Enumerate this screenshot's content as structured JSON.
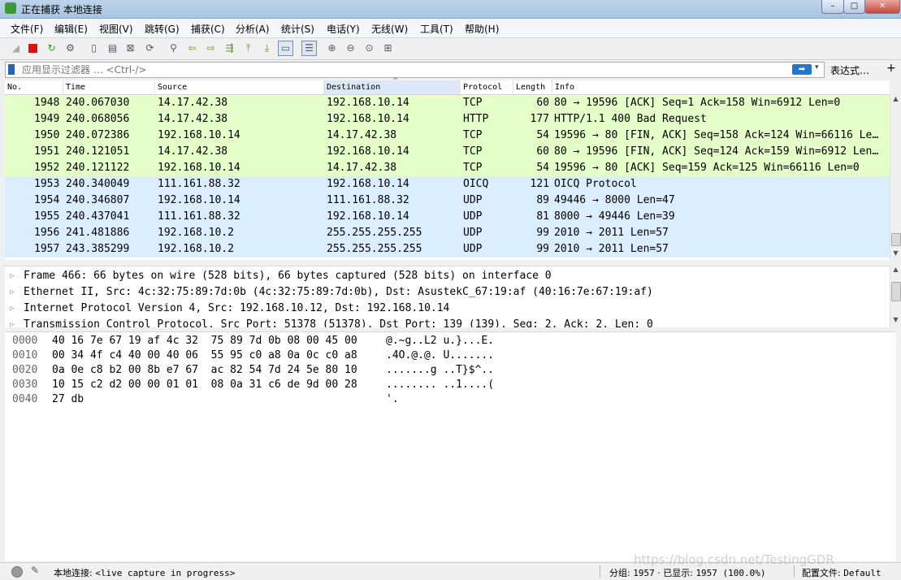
{
  "window": {
    "title": "正在捕获 本地连接",
    "min": "–",
    "max": "□",
    "close": "✕"
  },
  "menu": [
    "文件(F)",
    "编辑(E)",
    "视图(V)",
    "跳转(G)",
    "捕获(C)",
    "分析(A)",
    "统计(S)",
    "电话(Y)",
    "无线(W)",
    "工具(T)",
    "帮助(H)"
  ],
  "filter": {
    "placeholder": "应用显示过滤器 … <Ctrl-/>",
    "apply": "➡",
    "dropdown": "▾",
    "expression_button": "表达式…",
    "add_button": "+"
  },
  "columns": [
    "No.",
    "Time",
    "Source",
    "Destination",
    "Protocol",
    "Length",
    "Info"
  ],
  "sort_indicator": "^",
  "colors": {
    "tcp_row": "#e4ffc7",
    "udp_row": "#daeeff",
    "window_accent": "#a9c4e2"
  },
  "packets": [
    {
      "no": "1948",
      "time": "240.067030",
      "src": "14.17.42.38",
      "dst": "192.168.10.14",
      "proto": "TCP",
      "len": "60",
      "info": "80 → 19596 [ACK] Seq=1 Ack=158 Win=6912 Len=0",
      "kind": "tcp"
    },
    {
      "no": "1949",
      "time": "240.068056",
      "src": "14.17.42.38",
      "dst": "192.168.10.14",
      "proto": "HTTP",
      "len": "177",
      "info": "HTTP/1.1 400 Bad Request",
      "kind": "tcp"
    },
    {
      "no": "1950",
      "time": "240.072386",
      "src": "192.168.10.14",
      "dst": "14.17.42.38",
      "proto": "TCP",
      "len": "54",
      "info": "19596 → 80 [FIN, ACK] Seq=158 Ack=124 Win=66116 Le…",
      "kind": "tcp"
    },
    {
      "no": "1951",
      "time": "240.121051",
      "src": "14.17.42.38",
      "dst": "192.168.10.14",
      "proto": "TCP",
      "len": "60",
      "info": "80 → 19596 [FIN, ACK] Seq=124 Ack=159 Win=6912 Len…",
      "kind": "tcp"
    },
    {
      "no": "1952",
      "time": "240.121122",
      "src": "192.168.10.14",
      "dst": "14.17.42.38",
      "proto": "TCP",
      "len": "54",
      "info": "19596 → 80 [ACK] Seq=159 Ack=125 Win=66116 Len=0",
      "kind": "tcp"
    },
    {
      "no": "1953",
      "time": "240.340049",
      "src": "111.161.88.32",
      "dst": "192.168.10.14",
      "proto": "OICQ",
      "len": "121",
      "info": "OICQ Protocol",
      "kind": "udp"
    },
    {
      "no": "1954",
      "time": "240.346807",
      "src": "192.168.10.14",
      "dst": "111.161.88.32",
      "proto": "UDP",
      "len": "89",
      "info": "49446 → 8000  Len=47",
      "kind": "udp"
    },
    {
      "no": "1955",
      "time": "240.437041",
      "src": "111.161.88.32",
      "dst": "192.168.10.14",
      "proto": "UDP",
      "len": "81",
      "info": "8000 → 49446  Len=39",
      "kind": "udp"
    },
    {
      "no": "1956",
      "time": "241.481886",
      "src": "192.168.10.2",
      "dst": "255.255.255.255",
      "proto": "UDP",
      "len": "99",
      "info": "2010 → 2011  Len=57",
      "kind": "udp"
    },
    {
      "no": "1957",
      "time": "243.385299",
      "src": "192.168.10.2",
      "dst": "255.255.255.255",
      "proto": "UDP",
      "len": "99",
      "info": "2010 → 2011  Len=57",
      "kind": "udp"
    }
  ],
  "details": [
    "Frame 466: 66 bytes on wire (528 bits), 66 bytes captured (528 bits) on interface 0",
    "Ethernet II, Src: 4c:32:75:89:7d:0b (4c:32:75:89:7d:0b), Dst: AsustekC_67:19:af (40:16:7e:67:19:af)",
    "Internet Protocol Version 4, Src: 192.168.10.12, Dst: 192.168.10.14",
    "Transmission Control Protocol, Src Port: 51378 (51378), Dst Port: 139 (139), Seq: 2, Ack: 2, Len: 0"
  ],
  "expander": "▷",
  "bytes": [
    {
      "off": "0000",
      "hex": "40 16 7e 67 19 af 4c 32  75 89 7d 0b 08 00 45 00",
      "ascii": "@.~g..L2 u.}...E."
    },
    {
      "off": "0010",
      "hex": "00 34 4f c4 40 00 40 06  55 95 c0 a8 0a 0c c0 a8",
      "ascii": ".4O.@.@. U......."
    },
    {
      "off": "0020",
      "hex": "0a 0e c8 b2 00 8b e7 67  ac 82 54 7d 24 5e 80 10",
      "ascii": ".......g ..T}$^.."
    },
    {
      "off": "0030",
      "hex": "10 15 c2 d2 00 00 01 01  08 0a 31 c6 de 9d 00 28",
      "ascii": "........ ..1....("
    },
    {
      "off": "0040",
      "hex": "27 db",
      "ascii": "'."
    }
  ],
  "status": {
    "capture_label": "本地连接:",
    "capture_state": "<live capture in progress>",
    "packets_label": "分组:",
    "packets_count": "1957",
    "separator": "·",
    "displayed_label": "已显示:",
    "displayed_value": "1957 (100.0%)",
    "profile_label": "配置文件:",
    "profile_value": "Default"
  },
  "watermark": "https://blog.csdn.net/TestingGDR"
}
